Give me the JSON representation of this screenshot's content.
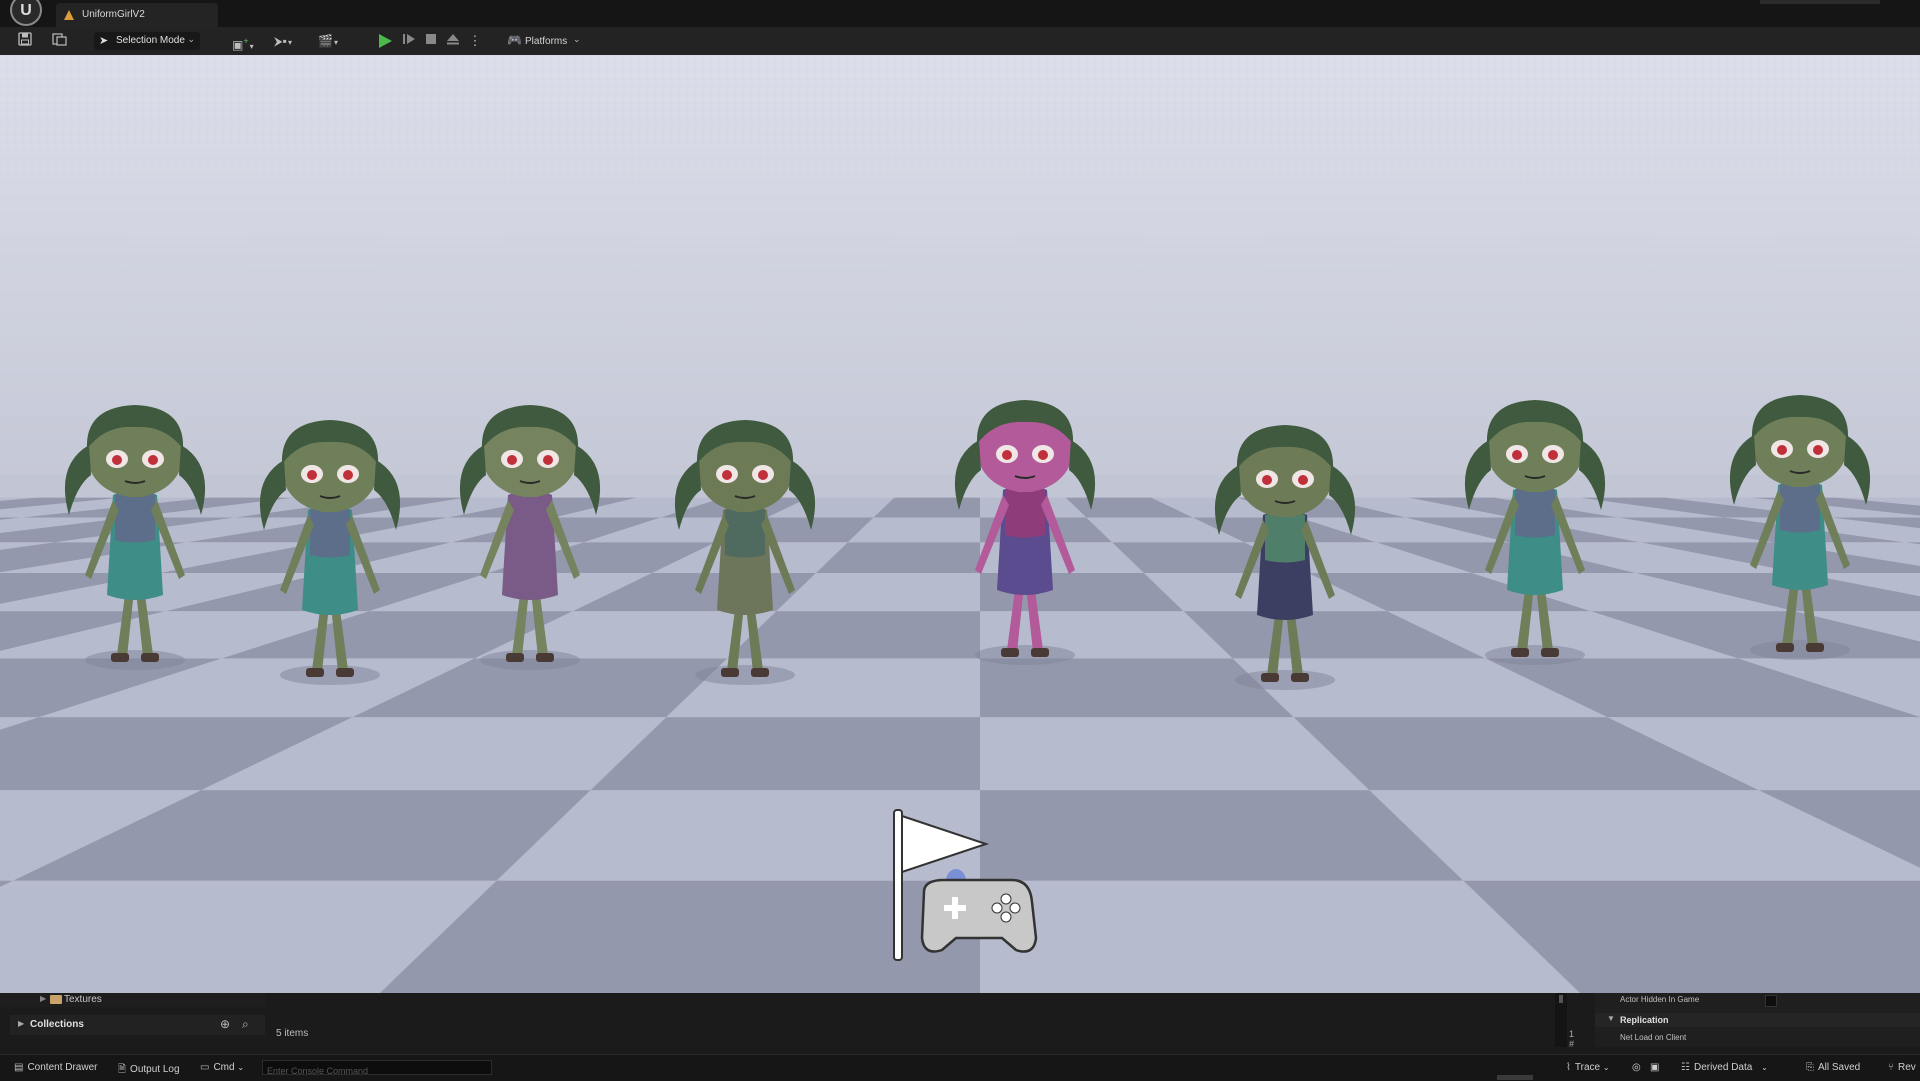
{
  "window": {
    "title": "UniformGirlV2",
    "logo_icon": "unreal-engine-logo"
  },
  "toolbar": {
    "save_icon": "save-icon",
    "browse_icon": "content-browser-icon",
    "selection_mode_label": "Selection Mode",
    "add_icon": "add-actor-icon",
    "snap_icon": "blueprint-icon",
    "cinematics_icon": "clapperboard-icon",
    "play_icon": "play-icon",
    "advance_icon": "step-icon",
    "stop_icon": "stop-icon",
    "eject_icon": "eject-icon",
    "more_icon": "more-options-icon",
    "platforms_label": "Platforms"
  },
  "viewport": {
    "sky_color": "#d6d8e6",
    "floor_light": "#b7bbce",
    "floor_dark": "#9498ad",
    "player_start_icon": "player-start-flag-gamepad-icon",
    "characters": [
      {
        "variant": "skin-green-dress-teal"
      },
      {
        "variant": "skin-green-dress-teal"
      },
      {
        "variant": "skin-green-outfit-purple"
      },
      {
        "variant": "skin-green-shirt-torn"
      },
      {
        "variant": "skin-pink-outfit-purple"
      },
      {
        "variant": "skin-green-dress-dark"
      },
      {
        "variant": "skin-green-dress-teal"
      },
      {
        "variant": "skin-green-dress-teal"
      }
    ]
  },
  "content_browser": {
    "tree_item_label": "Textures",
    "collections_label": "Collections",
    "items_count": "5 items"
  },
  "details": {
    "actor_hidden_label": "Actor Hidden In Game",
    "section_label": "Replication",
    "net_load_label": "Net Load on Client",
    "divider_number": "1 #"
  },
  "statusbar": {
    "content_drawer": "Content Drawer",
    "output_log": "Output Log",
    "cmd": "Cmd",
    "console_placeholder": "Enter Console Command",
    "trace": "Trace",
    "derived_data": "Derived Data",
    "all_saved": "All Saved",
    "revision": "Rev"
  }
}
